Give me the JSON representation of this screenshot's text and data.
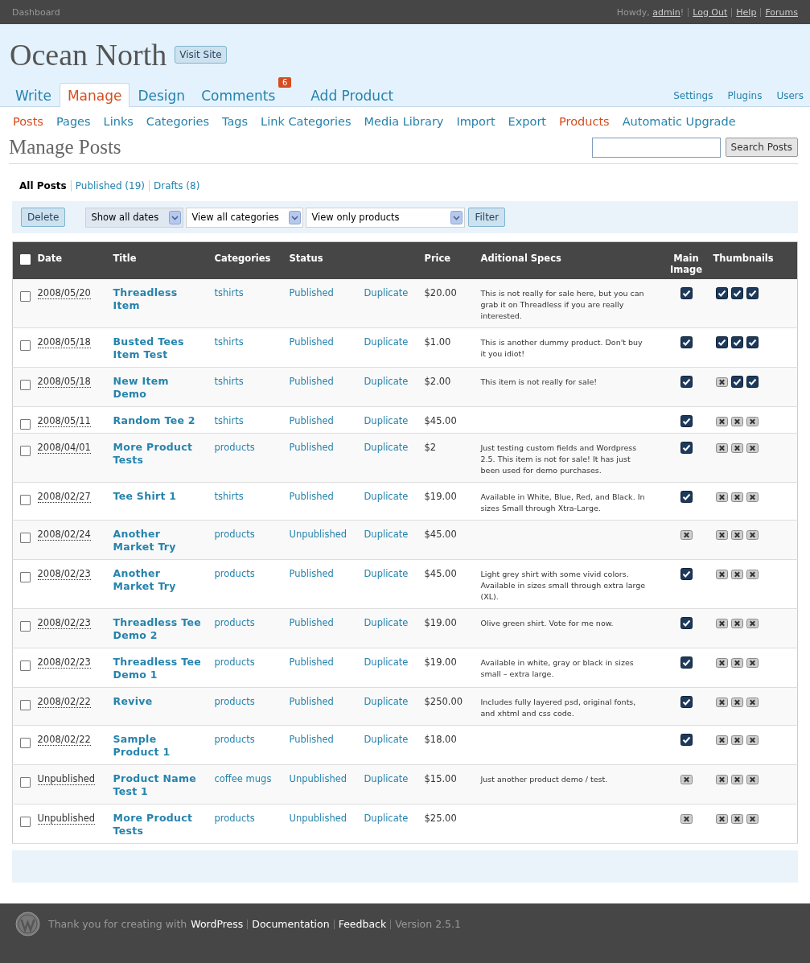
{
  "top_bar": {
    "dashboard": "Dashboard",
    "greeting": {
      "before": "Howdy, ",
      "user": "admin",
      "after": "!"
    },
    "links": [
      "Log Out",
      "Help",
      "Forums"
    ]
  },
  "site": {
    "title": "Ocean North",
    "visit_button": "Visit Site"
  },
  "main_menu": [
    {
      "label": "Write",
      "selected": false
    },
    {
      "label": "Manage",
      "selected": true
    },
    {
      "label": "Design",
      "selected": false
    },
    {
      "label": "Comments",
      "selected": false,
      "badge": "6"
    },
    {
      "label": "Add Product",
      "selected": false
    }
  ],
  "side_menu": [
    "Settings",
    "Plugins",
    "Users"
  ],
  "sub_menu": [
    {
      "label": "Posts",
      "selected": true
    },
    {
      "label": "Pages",
      "selected": false
    },
    {
      "label": "Links",
      "selected": false
    },
    {
      "label": "Categories",
      "selected": false
    },
    {
      "label": "Tags",
      "selected": false
    },
    {
      "label": "Link Categories",
      "selected": false
    },
    {
      "label": "Media Library",
      "selected": false
    },
    {
      "label": "Import",
      "selected": false
    },
    {
      "label": "Export",
      "selected": false
    },
    {
      "label": "Products",
      "selected": true
    },
    {
      "label": "Automatic Upgrade",
      "selected": false
    }
  ],
  "page_title": "Manage Posts",
  "search": {
    "button": "Search Posts"
  },
  "views": [
    {
      "label": "All Posts",
      "selected": true
    },
    {
      "label": "Published (19)",
      "selected": false
    },
    {
      "label": "Drafts (8)",
      "selected": false
    }
  ],
  "filters": {
    "delete_button": "Delete",
    "selects": [
      "Show all dates",
      "View all categories",
      "View only products"
    ],
    "filter_button": "Filter"
  },
  "table": {
    "select_all_checked": false,
    "columns": [
      "Date",
      "Title",
      "Categories",
      "Status",
      "Price",
      "Aditional Specs",
      "Main Image",
      "Thumbnails"
    ],
    "rows": [
      {
        "checked": false,
        "date": "2008/05/20",
        "title": "Threadless Item",
        "category": "tshirts",
        "status": "Published",
        "action": "Duplicate",
        "price": "$20.00",
        "specs": "This is not really for sale here, but you can grab it on Threadless if you are really interested.",
        "main_image": true,
        "thumbnails": [
          true,
          true,
          true
        ]
      },
      {
        "checked": false,
        "date": "2008/05/18",
        "title": "Busted Tees Item Test",
        "category": "tshirts",
        "status": "Published",
        "action": "Duplicate",
        "price": "$1.00",
        "specs": "This is another dummy product. Don't buy it you idiot!",
        "main_image": true,
        "thumbnails": [
          true,
          true,
          true
        ]
      },
      {
        "checked": false,
        "date": "2008/05/18",
        "title": "New Item Demo",
        "category": "tshirts",
        "status": "Published",
        "action": "Duplicate",
        "price": "$2.00",
        "specs": "This item is not really for sale!",
        "main_image": true,
        "thumbnails": [
          false,
          true,
          true
        ]
      },
      {
        "checked": false,
        "date": "2008/05/11",
        "title": "Random Tee 2",
        "category": "tshirts",
        "status": "Published",
        "action": "Duplicate",
        "price": "$45.00",
        "main_image": true,
        "thumbnails": [
          false,
          false,
          false
        ]
      },
      {
        "checked": false,
        "date": "2008/04/01",
        "title": "More Product Tests",
        "category": "products",
        "status": "Published",
        "action": "Duplicate",
        "price": "$2",
        "specs": "Just testing custom fields and Wordpress 2.5. This item is not for sale! It has just been used for demo purchases.",
        "main_image": true,
        "thumbnails": [
          false,
          false,
          false
        ]
      },
      {
        "checked": false,
        "date": "2008/02/27",
        "title": "Tee Shirt 1",
        "category": "tshirts",
        "status": "Published",
        "action": "Duplicate",
        "price": "$19.00",
        "specs": "Available in White, Blue, Red, and Black. In sizes Small through Xtra-Large.",
        "main_image": true,
        "thumbnails": [
          false,
          false,
          false
        ]
      },
      {
        "checked": false,
        "date": "2008/02/24",
        "title": "Another Market Try",
        "category": "products",
        "status": "Unpublished",
        "action": "Duplicate",
        "price": "$45.00",
        "main_image": false,
        "thumbnails": [
          false,
          false,
          false
        ]
      },
      {
        "checked": false,
        "date": "2008/02/23",
        "title": "Another Market Try",
        "category": "products",
        "status": "Published",
        "action": "Duplicate",
        "price": "$45.00",
        "specs": "Light grey shirt with some vivid colors. Available in sizes small through extra large (XL).",
        "main_image": true,
        "thumbnails": [
          false,
          false,
          false
        ]
      },
      {
        "checked": false,
        "date": "2008/02/23",
        "title": "Threadless Tee Demo 2",
        "category": "products",
        "status": "Published",
        "action": "Duplicate",
        "price": "$19.00",
        "specs": "Olive green shirt. Vote for me now.",
        "main_image": true,
        "thumbnails": [
          false,
          false,
          false
        ]
      },
      {
        "checked": false,
        "date": "2008/02/23",
        "title": "Threadless Tee Demo 1",
        "category": "products",
        "status": "Published",
        "action": "Duplicate",
        "price": "$19.00",
        "specs": "Available in white, gray or black in sizes small – extra large.",
        "main_image": true,
        "thumbnails": [
          false,
          false,
          false
        ]
      },
      {
        "checked": false,
        "date": "2008/02/22",
        "title": "Revive",
        "category": "products",
        "status": "Published",
        "action": "Duplicate",
        "price": "$250.00",
        "specs": "Includes fully layered psd, original fonts, and xhtml and css code.",
        "main_image": true,
        "thumbnails": [
          false,
          false,
          false
        ]
      },
      {
        "checked": false,
        "date": "2008/02/22",
        "title": "Sample Product 1",
        "category": "products",
        "status": "Published",
        "action": "Duplicate",
        "price": "$18.00",
        "main_image": true,
        "thumbnails": [
          false,
          false,
          false
        ]
      },
      {
        "checked": false,
        "date": "Unpublished",
        "title": "Product Name Test 1",
        "category": "coffee mugs",
        "status": "Unpublished",
        "action": "Duplicate",
        "price": "$15.00",
        "specs": "Just another product demo / test.",
        "main_image": false,
        "thumbnails": [
          false,
          false,
          false
        ]
      },
      {
        "checked": false,
        "date": "Unpublished",
        "title": "More Product Tests",
        "category": "products",
        "status": "Unpublished",
        "action": "Duplicate",
        "price": "$25.00",
        "main_image": false,
        "thumbnails": [
          false,
          false,
          false
        ]
      }
    ]
  },
  "footer": {
    "before": "Thank you for creating with",
    "links": [
      "WordPress",
      "Documentation",
      "Feedback"
    ],
    "version": "Version 2.5.1"
  }
}
